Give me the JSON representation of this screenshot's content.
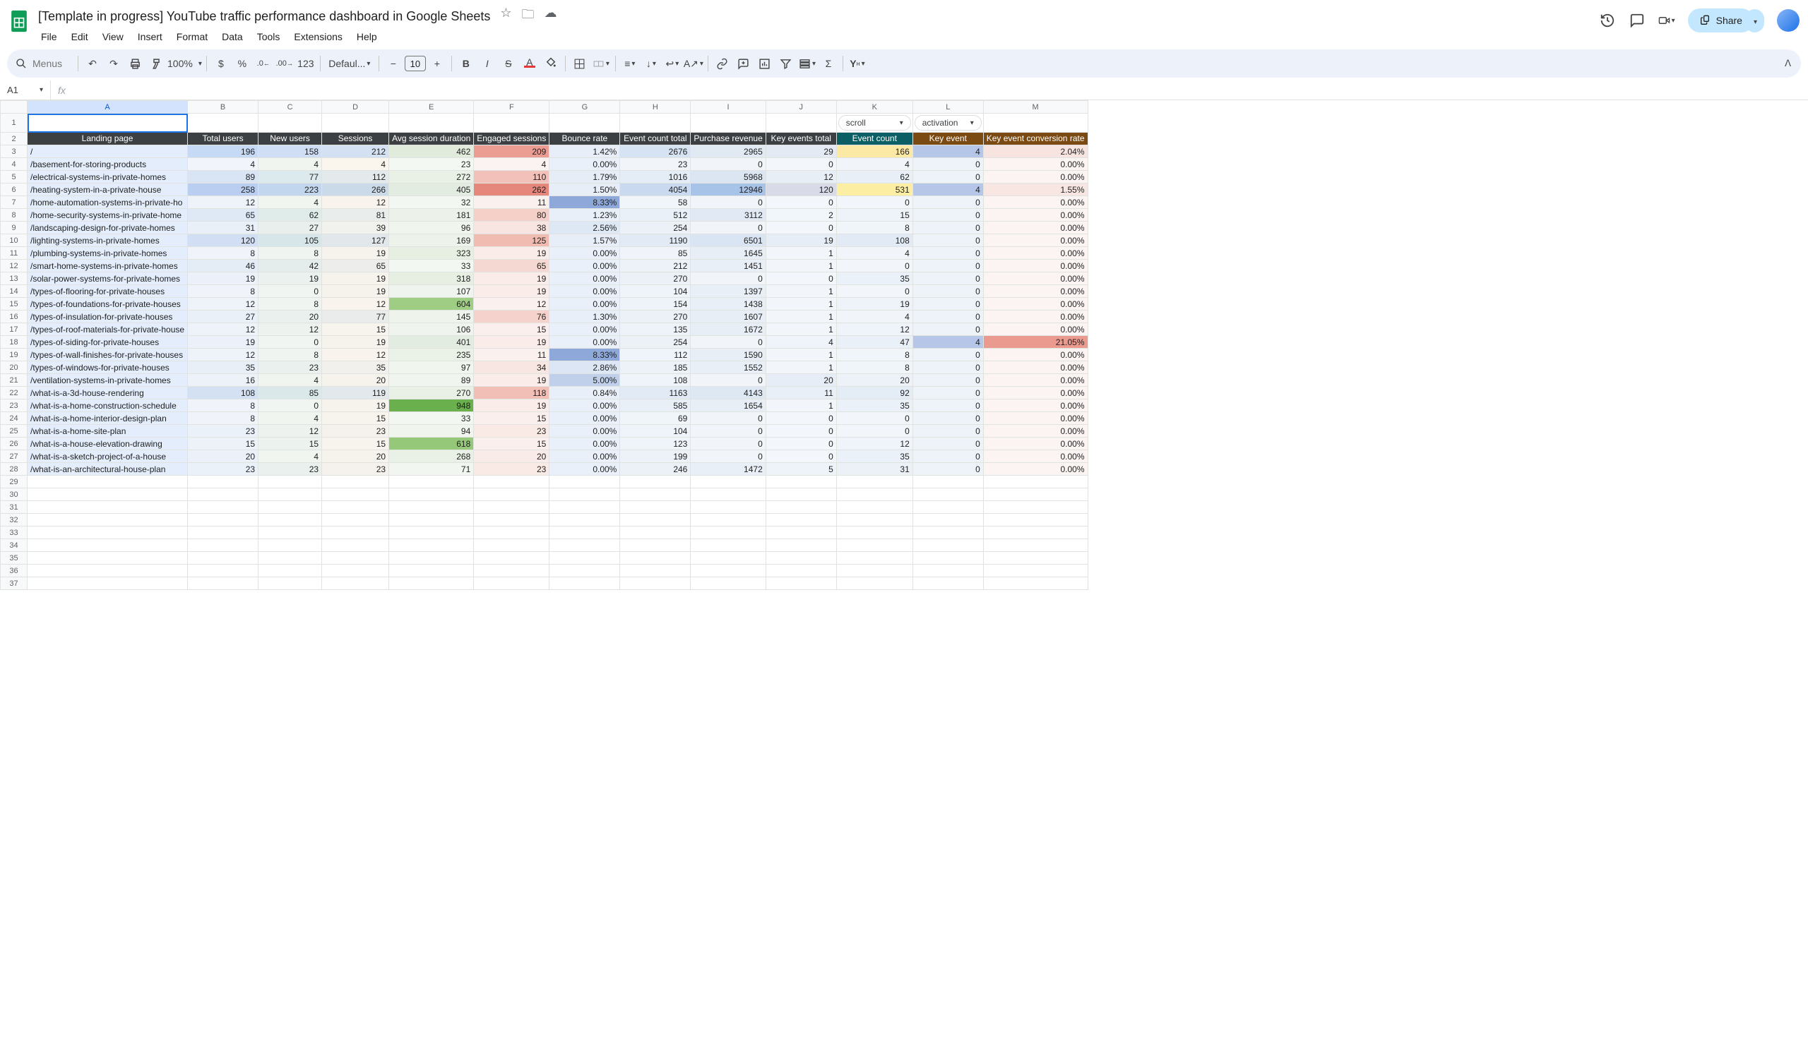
{
  "doc": {
    "title": "[Template in progress] YouTube traffic performance dashboard in Google Sheets"
  },
  "menus": {
    "file": "File",
    "edit": "Edit",
    "view": "View",
    "insert": "Insert",
    "format": "Format",
    "data": "Data",
    "tools": "Tools",
    "extensions": "Extensions",
    "help": "Help"
  },
  "share": {
    "label": "Share"
  },
  "toolbar": {
    "search_ph": "Menus",
    "zoom": "100%",
    "font": "Defaul...",
    "size": "10"
  },
  "namebox": {
    "ref": "A1"
  },
  "cols": [
    "A",
    "B",
    "C",
    "D",
    "E",
    "F",
    "G",
    "H",
    "I",
    "J",
    "K",
    "L",
    "M"
  ],
  "dropdowns": {
    "k": "scroll",
    "l": "activation"
  },
  "headers": {
    "a": "Landing page",
    "b": "Total users",
    "c": "New users",
    "d": "Sessions",
    "e": "Avg session duration",
    "f": "Engaged sessions",
    "g": "Bounce rate",
    "h": "Event count total",
    "i": "Purchase revenue",
    "j": "Key events total",
    "k": "Event count",
    "l": "Key event",
    "m": "Key event conversion rate"
  },
  "rows": [
    {
      "a": "/",
      "b": "196",
      "c": "158",
      "d": "212",
      "e": "462",
      "f": "209",
      "g": "1.42%",
      "h": "2676",
      "i": "2965",
      "j": "29",
      "k": "166",
      "l": "4",
      "m": "2.04%",
      "bg": {
        "b": "#c6d9f5",
        "c": "#cfdef4",
        "d": "#d4e1f2",
        "e": "#e1ebdc",
        "f": "#eb9d94",
        "g": "#e8eef8",
        "h": "#d6e3f2",
        "i": "#e1e9f3",
        "j": "#e4eaf3",
        "k": "#fde9a6",
        "l": "#b6c6e8",
        "m": "#f7e3df"
      }
    },
    {
      "a": "/basement-for-storing-products",
      "b": "4",
      "c": "4",
      "d": "4",
      "e": "23",
      "f": "4",
      "g": "0.00%",
      "h": "23",
      "i": "0",
      "j": "0",
      "k": "4",
      "l": "0",
      "m": "0.00%",
      "bg": {
        "b": "#f1f5fb",
        "c": "#f0f5f0",
        "d": "#faf6ee",
        "e": "#f4f8f2",
        "f": "#fbf3f1",
        "g": "#eaf0f9",
        "h": "#f1f5fa",
        "i": "#f1f5fa",
        "j": "#f3f7fb",
        "k": "#f1f5fa",
        "l": "#eef3fa",
        "m": "#fbf4f3"
      }
    },
    {
      "a": "/electrical-systems-in-private-homes",
      "b": "89",
      "c": "77",
      "d": "112",
      "e": "272",
      "f": "110",
      "g": "1.79%",
      "h": "1016",
      "i": "5968",
      "j": "12",
      "k": "62",
      "l": "0",
      "m": "0.00%",
      "bg": {
        "b": "#d9e5f4",
        "c": "#ddeaed",
        "d": "#e4e9ec",
        "e": "#e9f0e5",
        "f": "#f2c2ba",
        "g": "#e6edf7",
        "h": "#e4ecf5",
        "i": "#dbe6f2",
        "j": "#e8eef6",
        "k": "#e8eff7",
        "l": "#eef3fa",
        "m": "#fbf4f3"
      }
    },
    {
      "a": "/heating-system-in-a-private-house",
      "b": "258",
      "c": "223",
      "d": "266",
      "e": "405",
      "f": "262",
      "g": "1.50%",
      "h": "4054",
      "i": "12946",
      "j": "120",
      "k": "531",
      "l": "4",
      "m": "1.55%",
      "bg": {
        "b": "#b9cef0",
        "c": "#c2d7ed",
        "d": "#cbdae9",
        "e": "#e3ece0",
        "f": "#e6877c",
        "g": "#e7eef8",
        "h": "#c9daf0",
        "i": "#a8c3e8",
        "j": "#d8dae8",
        "k": "#fceea2",
        "l": "#b6c6e8",
        "m": "#f7e6e2"
      }
    },
    {
      "a": "/home-automation-systems-in-private-ho",
      "b": "12",
      "c": "4",
      "d": "12",
      "e": "32",
      "f": "11",
      "g": "8.33%",
      "h": "58",
      "i": "0",
      "j": "0",
      "k": "0",
      "l": "0",
      "m": "0.00%",
      "bg": {
        "b": "#eef3fa",
        "c": "#f0f5f0",
        "d": "#f8f3ed",
        "e": "#f3f7f1",
        "f": "#faf1ef",
        "g": "#8fa8da",
        "h": "#f0f5fa",
        "i": "#f1f5fa",
        "j": "#f3f7fb",
        "k": "#f2f6fb",
        "l": "#eef3fa",
        "m": "#fbf4f3"
      }
    },
    {
      "a": "/home-security-systems-in-private-home",
      "b": "65",
      "c": "62",
      "d": "81",
      "e": "181",
      "f": "80",
      "g": "1.23%",
      "h": "512",
      "i": "3112",
      "j": "2",
      "k": "15",
      "l": "0",
      "m": "0.00%",
      "bg": {
        "b": "#dfe9f6",
        "c": "#dfecea",
        "d": "#e9edec",
        "e": "#ecf2e9",
        "f": "#f5d0c9",
        "g": "#e8eff8",
        "h": "#e9f0f7",
        "i": "#e1eaf4",
        "j": "#f1f6fb",
        "k": "#eef3fa",
        "l": "#eef3fa",
        "m": "#fbf4f3"
      }
    },
    {
      "a": "/landscaping-design-for-private-homes",
      "b": "31",
      "c": "27",
      "d": "39",
      "e": "96",
      "f": "38",
      "g": "2.56%",
      "h": "254",
      "i": "0",
      "j": "0",
      "k": "8",
      "l": "0",
      "m": "0.00%",
      "bg": {
        "b": "#e9f0f8",
        "c": "#e8efed",
        "d": "#f1f1ed",
        "e": "#f0f5ee",
        "f": "#f8e4e0",
        "g": "#dee8f5",
        "h": "#ecf1f8",
        "i": "#f1f5fa",
        "j": "#f3f7fb",
        "k": "#f0f5fa",
        "l": "#eef3fa",
        "m": "#fbf4f3"
      }
    },
    {
      "a": "/lighting-systems-in-private-homes",
      "b": "120",
      "c": "105",
      "d": "127",
      "e": "169",
      "f": "125",
      "g": "1.57%",
      "h": "1190",
      "i": "6501",
      "j": "19",
      "k": "108",
      "l": "0",
      "m": "0.00%",
      "bg": {
        "b": "#d1def3",
        "c": "#d6e6e9",
        "d": "#e1e7ea",
        "e": "#edf2ea",
        "f": "#f0bbb1",
        "g": "#e7eef8",
        "h": "#e2ebf5",
        "i": "#d9e5f2",
        "j": "#e6edf6",
        "k": "#e2ebf5",
        "l": "#eef3fa",
        "m": "#fbf4f3"
      }
    },
    {
      "a": "/plumbing-systems-in-private-homes",
      "b": "8",
      "c": "8",
      "d": "19",
      "e": "323",
      "f": "19",
      "g": "0.00%",
      "h": "85",
      "i": "1645",
      "j": "1",
      "k": "4",
      "l": "0",
      "m": "0.00%",
      "bg": {
        "b": "#f0f4fa",
        "c": "#eff4f0",
        "d": "#f6f2ec",
        "e": "#e7efe3",
        "f": "#f9ece9",
        "g": "#eaf0f9",
        "h": "#f0f4fa",
        "i": "#e7eef6",
        "j": "#f2f6fb",
        "k": "#f1f5fa",
        "l": "#eef3fa",
        "m": "#fbf4f3"
      }
    },
    {
      "a": "/smart-home-systems-in-private-homes",
      "b": "46",
      "c": "42",
      "d": "65",
      "e": "33",
      "f": "65",
      "g": "0.00%",
      "h": "212",
      "i": "1451",
      "j": "1",
      "k": "0",
      "l": "0",
      "m": "0.00%",
      "bg": {
        "b": "#e4ecf6",
        "c": "#e4edeb",
        "d": "#edeeec",
        "e": "#f3f7f1",
        "f": "#f6d8d2",
        "g": "#eaf0f9",
        "h": "#edf2f9",
        "i": "#e8eff7",
        "j": "#f2f6fb",
        "k": "#f2f6fb",
        "l": "#eef3fa",
        "m": "#fbf4f3"
      }
    },
    {
      "a": "/solar-power-systems-for-private-homes",
      "b": "19",
      "c": "19",
      "d": "19",
      "e": "318",
      "f": "19",
      "g": "0.00%",
      "h": "270",
      "i": "0",
      "j": "0",
      "k": "35",
      "l": "0",
      "m": "0.00%",
      "bg": {
        "b": "#ecf1f9",
        "c": "#ebf1ee",
        "d": "#f6f2ec",
        "e": "#e7efe3",
        "f": "#f9ece9",
        "g": "#eaf0f9",
        "h": "#ecf1f8",
        "i": "#f1f5fa",
        "j": "#f3f7fb",
        "k": "#ebf1f8",
        "l": "#eef3fa",
        "m": "#fbf4f3"
      }
    },
    {
      "a": "/types-of-flooring-for-private-houses",
      "b": "8",
      "c": "0",
      "d": "19",
      "e": "107",
      "f": "19",
      "g": "0.00%",
      "h": "104",
      "i": "1397",
      "j": "1",
      "k": "0",
      "l": "0",
      "m": "0.00%",
      "bg": {
        "b": "#f0f4fa",
        "c": "#f1f5f1",
        "d": "#f6f2ec",
        "e": "#f0f4ee",
        "f": "#f9ece9",
        "g": "#eaf0f9",
        "h": "#eff4fa",
        "i": "#e8eff7",
        "j": "#f2f6fb",
        "k": "#f2f6fb",
        "l": "#eef3fa",
        "m": "#fbf4f3"
      }
    },
    {
      "a": "/types-of-foundations-for-private-houses",
      "b": "12",
      "c": "8",
      "d": "12",
      "e": "604",
      "f": "12",
      "g": "0.00%",
      "h": "154",
      "i": "1438",
      "j": "1",
      "k": "19",
      "l": "0",
      "m": "0.00%",
      "bg": {
        "b": "#eef3fa",
        "c": "#eff4f0",
        "d": "#f8f3ed",
        "e": "#9fcd83",
        "f": "#faf0ee",
        "g": "#eaf0f9",
        "h": "#eef3f9",
        "i": "#e8eff7",
        "j": "#f2f6fb",
        "k": "#eef3fa",
        "l": "#eef3fa",
        "m": "#fbf4f3"
      }
    },
    {
      "a": "/types-of-insulation-for-private-houses",
      "b": "27",
      "c": "20",
      "d": "77",
      "e": "145",
      "f": "76",
      "g": "1.30%",
      "h": "270",
      "i": "1607",
      "j": "1",
      "k": "4",
      "l": "0",
      "m": "0.00%",
      "bg": {
        "b": "#eaf0f8",
        "c": "#eaf0ed",
        "d": "#eaecec",
        "e": "#eef3ec",
        "f": "#f5d2cb",
        "g": "#e8eff8",
        "h": "#ecf1f8",
        "i": "#e7eef6",
        "j": "#f2f6fb",
        "k": "#f1f5fa",
        "l": "#eef3fa",
        "m": "#fbf4f3"
      }
    },
    {
      "a": "/types-of-roof-materials-for-private-house",
      "b": "12",
      "c": "12",
      "d": "15",
      "e": "106",
      "f": "15",
      "g": "0.00%",
      "h": "135",
      "i": "1672",
      "j": "1",
      "k": "12",
      "l": "0",
      "m": "0.00%",
      "bg": {
        "b": "#eef3fa",
        "c": "#edf2ef",
        "d": "#f7f3ed",
        "e": "#f0f4ee",
        "f": "#faefec",
        "g": "#eaf0f9",
        "h": "#eef3f9",
        "i": "#e7eef6",
        "j": "#f2f6fb",
        "k": "#eff4fa",
        "l": "#eef3fa",
        "m": "#fbf4f3"
      }
    },
    {
      "a": "/types-of-siding-for-private-houses",
      "b": "19",
      "c": "0",
      "d": "19",
      "e": "401",
      "f": "19",
      "g": "0.00%",
      "h": "254",
      "i": "0",
      "j": "4",
      "k": "47",
      "l": "4",
      "m": "21.05%",
      "bg": {
        "b": "#ecf1f9",
        "c": "#f1f5f1",
        "d": "#f6f2ec",
        "e": "#e3ece0",
        "f": "#f9ece9",
        "g": "#eaf0f9",
        "h": "#ecf1f8",
        "i": "#f1f5fa",
        "j": "#eff4fa",
        "k": "#eaf0f8",
        "l": "#b6c6e8",
        "m": "#ea9a8e"
      }
    },
    {
      "a": "/types-of-wall-finishes-for-private-houses",
      "b": "12",
      "c": "8",
      "d": "12",
      "e": "235",
      "f": "11",
      "g": "8.33%",
      "h": "112",
      "i": "1590",
      "j": "1",
      "k": "8",
      "l": "0",
      "m": "0.00%",
      "bg": {
        "b": "#eef3fa",
        "c": "#eff4f0",
        "d": "#f8f3ed",
        "e": "#eaf1e6",
        "f": "#faf1ef",
        "g": "#8fa8da",
        "h": "#eff4fa",
        "i": "#e7eef6",
        "j": "#f2f6fb",
        "k": "#f0f5fa",
        "l": "#eef3fa",
        "m": "#fbf4f3"
      }
    },
    {
      "a": "/types-of-windows-for-private-houses",
      "b": "35",
      "c": "23",
      "d": "35",
      "e": "97",
      "f": "34",
      "g": "2.86%",
      "h": "185",
      "i": "1552",
      "j": "1",
      "k": "8",
      "l": "0",
      "m": "0.00%",
      "bg": {
        "b": "#e8eff7",
        "c": "#e9f0ed",
        "d": "#f2f0ec",
        "e": "#f0f5ee",
        "f": "#f8e6e2",
        "g": "#dce6f4",
        "h": "#edf2f9",
        "i": "#e8eff7",
        "j": "#f2f6fb",
        "k": "#f0f5fa",
        "l": "#eef3fa",
        "m": "#fbf4f3"
      }
    },
    {
      "a": "/ventilation-systems-in-private-homes",
      "b": "16",
      "c": "4",
      "d": "20",
      "e": "89",
      "f": "19",
      "g": "5.00%",
      "h": "108",
      "i": "0",
      "j": "20",
      "k": "20",
      "l": "0",
      "m": "0.00%",
      "bg": {
        "b": "#edf2f9",
        "c": "#f0f5f0",
        "d": "#f6f2ec",
        "e": "#f1f5ef",
        "f": "#f9ece9",
        "g": "#c0d0ea",
        "h": "#eff4fa",
        "i": "#f1f5fa",
        "j": "#e6edf6",
        "k": "#edf2f9",
        "l": "#eef3fa",
        "m": "#fbf4f3"
      }
    },
    {
      "a": "/what-is-a-3d-house-rendering",
      "b": "108",
      "c": "85",
      "d": "119",
      "e": "270",
      "f": "118",
      "g": "0.84%",
      "h": "1163",
      "i": "4143",
      "j": "11",
      "k": "92",
      "l": "0",
      "m": "0.00%",
      "bg": {
        "b": "#d4e1f3",
        "c": "#dae8ea",
        "d": "#e2e8eb",
        "e": "#e9f0e5",
        "f": "#f1bfb6",
        "g": "#e9eff8",
        "h": "#e2ebf5",
        "i": "#dee8f3",
        "j": "#e8eff7",
        "k": "#e4ecf6",
        "l": "#eef3fa",
        "m": "#fbf4f3"
      }
    },
    {
      "a": "/what-is-a-home-construction-schedule",
      "b": "8",
      "c": "0",
      "d": "19",
      "e": "948",
      "f": "19",
      "g": "0.00%",
      "h": "585",
      "i": "1654",
      "j": "1",
      "k": "35",
      "l": "0",
      "m": "0.00%",
      "bg": {
        "b": "#f0f4fa",
        "c": "#f1f5f1",
        "d": "#f6f2ec",
        "e": "#6ab04c",
        "f": "#f9ece9",
        "g": "#eaf0f9",
        "h": "#e8eff7",
        "i": "#e7eef6",
        "j": "#f2f6fb",
        "k": "#ebf1f8",
        "l": "#eef3fa",
        "m": "#fbf4f3"
      }
    },
    {
      "a": "/what-is-a-home-interior-design-plan",
      "b": "8",
      "c": "4",
      "d": "15",
      "e": "33",
      "f": "15",
      "g": "0.00%",
      "h": "69",
      "i": "0",
      "j": "0",
      "k": "0",
      "l": "0",
      "m": "0.00%",
      "bg": {
        "b": "#f0f4fa",
        "c": "#f0f5f0",
        "d": "#f7f3ed",
        "e": "#f3f7f1",
        "f": "#faefec",
        "g": "#eaf0f9",
        "h": "#f0f5fa",
        "i": "#f1f5fa",
        "j": "#f3f7fb",
        "k": "#f2f6fb",
        "l": "#eef3fa",
        "m": "#fbf4f3"
      }
    },
    {
      "a": "/what-is-a-home-site-plan",
      "b": "23",
      "c": "12",
      "d": "23",
      "e": "94",
      "f": "23",
      "g": "0.00%",
      "h": "104",
      "i": "0",
      "j": "0",
      "k": "0",
      "l": "0",
      "m": "0.00%",
      "bg": {
        "b": "#ebf1f9",
        "c": "#edf2ef",
        "d": "#f5f1ec",
        "e": "#f0f5ee",
        "f": "#f9eae6",
        "g": "#eaf0f9",
        "h": "#eff4fa",
        "i": "#f1f5fa",
        "j": "#f3f7fb",
        "k": "#f2f6fb",
        "l": "#eef3fa",
        "m": "#fbf4f3"
      }
    },
    {
      "a": "/what-is-a-house-elevation-drawing",
      "b": "15",
      "c": "15",
      "d": "15",
      "e": "618",
      "f": "15",
      "g": "0.00%",
      "h": "123",
      "i": "0",
      "j": "0",
      "k": "12",
      "l": "0",
      "m": "0.00%",
      "bg": {
        "b": "#edf2f9",
        "c": "#ecf2ee",
        "d": "#f7f3ed",
        "e": "#96c879",
        "f": "#faefec",
        "g": "#eaf0f9",
        "h": "#eff4fa",
        "i": "#f1f5fa",
        "j": "#f3f7fb",
        "k": "#eff4fa",
        "l": "#eef3fa",
        "m": "#fbf4f3"
      }
    },
    {
      "a": "/what-is-a-sketch-project-of-a-house",
      "b": "20",
      "c": "4",
      "d": "20",
      "e": "268",
      "f": "20",
      "g": "0.00%",
      "h": "199",
      "i": "0",
      "j": "0",
      "k": "35",
      "l": "0",
      "m": "0.00%",
      "bg": {
        "b": "#ecf1f9",
        "c": "#f0f5f0",
        "d": "#f6f2ec",
        "e": "#e9f0e5",
        "f": "#f9ebe8",
        "g": "#eaf0f9",
        "h": "#edf2f9",
        "i": "#f1f5fa",
        "j": "#f3f7fb",
        "k": "#ebf1f8",
        "l": "#eef3fa",
        "m": "#fbf4f3"
      }
    },
    {
      "a": "/what-is-an-architectural-house-plan",
      "b": "23",
      "c": "23",
      "d": "23",
      "e": "71",
      "f": "23",
      "g": "0.00%",
      "h": "246",
      "i": "1472",
      "j": "5",
      "k": "31",
      "l": "0",
      "m": "0.00%",
      "bg": {
        "b": "#ebf1f9",
        "c": "#e9f0ed",
        "d": "#f5f1ec",
        "e": "#f2f6f0",
        "f": "#f9eae6",
        "g": "#eaf0f9",
        "h": "#ecf1f8",
        "i": "#e8eff7",
        "j": "#eef3fa",
        "k": "#ecf1f8",
        "l": "#eef3fa",
        "m": "#fbf4f3"
      }
    }
  ],
  "empty_rows": [
    29,
    30,
    31,
    32,
    33,
    34,
    35,
    36,
    37
  ]
}
